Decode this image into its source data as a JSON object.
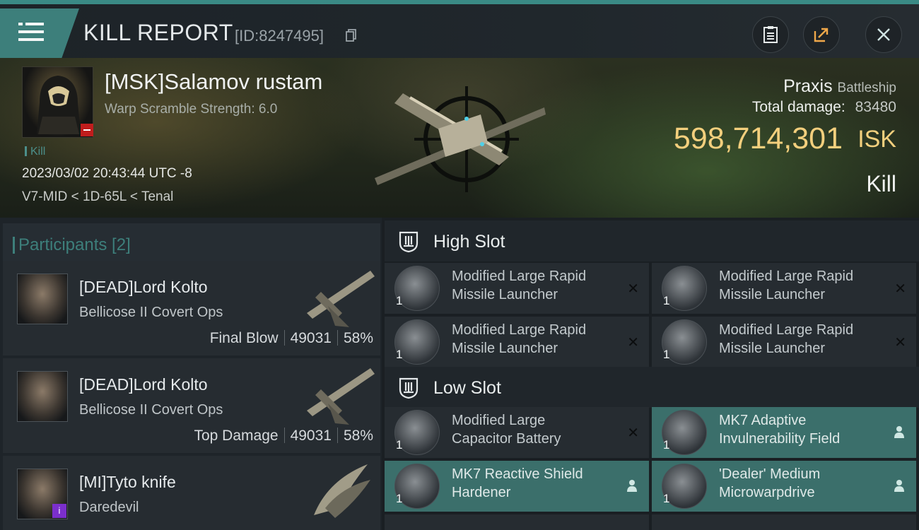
{
  "header": {
    "title": "KILL REPORT",
    "report_id": "[ID:8247495]"
  },
  "banner": {
    "pilot_name": "[MSK]Salamov rustam",
    "warp_scramble": "Warp Scramble Strength: 6.0",
    "kill_tag": "Kill",
    "timestamp": "2023/03/02 20:43:44 UTC -8",
    "location": "V7-MID < 1D-65L < Tenal",
    "ship_name": "Praxis",
    "ship_class": "Battleship",
    "total_damage_label": "Total damage:",
    "total_damage_value": "83480",
    "isk_value": "598,714,301",
    "isk_unit": "ISK",
    "result": "Kill"
  },
  "participants": {
    "title": "Participants [2]",
    "rows": [
      {
        "name": "[DEAD]Lord Kolto",
        "ship": "Bellicose II Covert Ops",
        "label": "Final Blow",
        "damage": "49031",
        "percent": "58%"
      },
      {
        "name": "[DEAD]Lord Kolto",
        "ship": "Bellicose II Covert Ops",
        "label": "Top Damage",
        "damage": "49031",
        "percent": "58%"
      },
      {
        "name": "[MI]Tyto knife",
        "ship": "Daredevil"
      }
    ]
  },
  "high_slot": {
    "title": "High Slot",
    "modules": [
      {
        "line1": "Modified Large Rapid",
        "line2": "Missile Launcher",
        "qty": "1"
      },
      {
        "line1": "Modified Large Rapid",
        "line2": "Missile Launcher",
        "qty": "1"
      },
      {
        "line1": "Modified Large Rapid",
        "line2": "Missile Launcher",
        "qty": "1"
      },
      {
        "line1": "Modified Large Rapid",
        "line2": "Missile Launcher",
        "qty": "1"
      }
    ]
  },
  "low_slot": {
    "title": "Low Slot",
    "modules": [
      {
        "line1": "Modified Large",
        "line2": "Capacitor Battery",
        "qty": "1"
      },
      {
        "line1": "MK7 Adaptive",
        "line2": "Invulnerability Field",
        "qty": "1"
      },
      {
        "line1": "MK7 Reactive Shield",
        "line2": "Hardener",
        "qty": "1"
      },
      {
        "line1": "'Dealer' Medium",
        "line2": "Microwarpdrive",
        "qty": "1"
      }
    ]
  },
  "colors": {
    "accent": "#3d7f7b",
    "isk": "#f3cf7d",
    "fitted_module": "#3b6f6b",
    "destroy_badge": "#c01d1d"
  },
  "icons": [
    "menu-icon",
    "copy-icon",
    "clipboard-icon",
    "share-icon",
    "close-icon",
    "slot-icon",
    "person-icon",
    "destroyed-x-icon"
  ]
}
